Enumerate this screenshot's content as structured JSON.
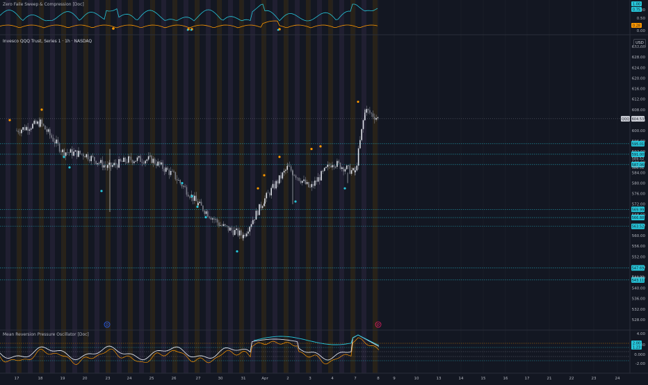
{
  "top_indicator": {
    "title": "Zero Faile Sweep & Compression [Doc]",
    "scale_labels": [
      "1.00",
      "0.50",
      "0.00"
    ],
    "badges": [
      {
        "text": "1.00",
        "color": "#26c6da"
      },
      {
        "text": "0.75",
        "color": "#26c6da"
      },
      {
        "text": "0.28",
        "color": "#ff9800"
      }
    ]
  },
  "main_chart": {
    "title": "Invesco QQQ Trust, Series 1 · 1h · NASDAQ",
    "currency": "USD",
    "ticker": "QQQ",
    "price_axis": [
      "632.00",
      "628.00",
      "624.00",
      "620.00",
      "616.00",
      "612.00",
      "608.00",
      "604.00",
      "600.00",
      "596.00",
      "592.00",
      "588.00",
      "584.00",
      "580.00",
      "576.00",
      "572.00",
      "568.00",
      "564.00",
      "560.00",
      "556.00",
      "552.00",
      "548.00",
      "544.00",
      "540.00",
      "536.00",
      "532.00",
      "528.00"
    ],
    "last_price": "604.53",
    "level_badges": [
      {
        "value": 595.01,
        "text": "595.01"
      },
      {
        "value": 591.0,
        "text": "591.00"
      },
      {
        "value": 587.06,
        "text": "587.06"
      },
      {
        "value": 569.99,
        "text": "569.99"
      },
      {
        "value": 566.88,
        "text": "566.88"
      },
      {
        "value": 563.52,
        "text": "563.52"
      },
      {
        "value": 547.69,
        "text": "547.69"
      },
      {
        "value": 543.11,
        "text": "543.11"
      }
    ],
    "extra_labels": [
      {
        "value": 586.0,
        "text": "586.51"
      },
      {
        "value": 589.4,
        "text": "589.52"
      },
      {
        "value": 544.2,
        "text": "544.00"
      }
    ]
  },
  "oscillator": {
    "title": "Mean Reversion Pressure Oscillator [Doc]",
    "scale_labels": [
      "4.00",
      "2.00",
      "0.000",
      "-2.00"
    ],
    "badges": [
      {
        "text": "2.00",
        "color": "#26c6da"
      },
      {
        "text": "1.23",
        "color": "#26c6da"
      }
    ]
  },
  "time_axis": {
    "labels": [
      "17",
      "18",
      "19",
      "20",
      "23",
      "24",
      "25",
      "26",
      "27",
      "30",
      "31",
      "Apr",
      "2",
      "3",
      "4",
      "7",
      "8",
      "9",
      "10",
      "13",
      "14",
      "15",
      "16",
      "17",
      "21",
      "22",
      "23",
      "24"
    ]
  },
  "markers": [
    {
      "symbol": "D",
      "color": "#2962ff"
    },
    {
      "symbol": "Ø",
      "color": "#e91e63"
    }
  ],
  "chart_data": {
    "type": "candlestick",
    "symbol": "QQQ",
    "interval": "1h",
    "exchange": "NASDAQ",
    "ylim": [
      526,
      634
    ],
    "close_series": [
      {
        "x": "Mar 17",
        "y": 600
      },
      {
        "x": "Mar 18",
        "y": 603
      },
      {
        "x": "Mar 19",
        "y": 592
      },
      {
        "x": "Mar 20",
        "y": 591
      },
      {
        "x": "Mar 23",
        "y": 586
      },
      {
        "x": "Mar 24",
        "y": 589
      },
      {
        "x": "Mar 25",
        "y": 589
      },
      {
        "x": "Mar 26",
        "y": 583
      },
      {
        "x": "Mar 27",
        "y": 572
      },
      {
        "x": "Mar 30",
        "y": 564
      },
      {
        "x": "Mar 31",
        "y": 560
      },
      {
        "x": "Apr 1",
        "y": 574
      },
      {
        "x": "Apr 2",
        "y": 586
      },
      {
        "x": "Apr 3",
        "y": 578
      },
      {
        "x": "Apr 6",
        "y": 588
      },
      {
        "x": "Apr 7",
        "y": 584
      },
      {
        "x": "Apr 8",
        "y": 608
      },
      {
        "x": "Apr 9",
        "y": 604.53
      }
    ],
    "levels": [
      595.01,
      591.0,
      587.06,
      569.99,
      566.88,
      563.52,
      547.69,
      543.11
    ]
  },
  "colors": {
    "background": "#131722",
    "band": "#2a2517",
    "cyan": "#26c6da",
    "orange": "#ff9800",
    "grid": "#1e222d"
  }
}
